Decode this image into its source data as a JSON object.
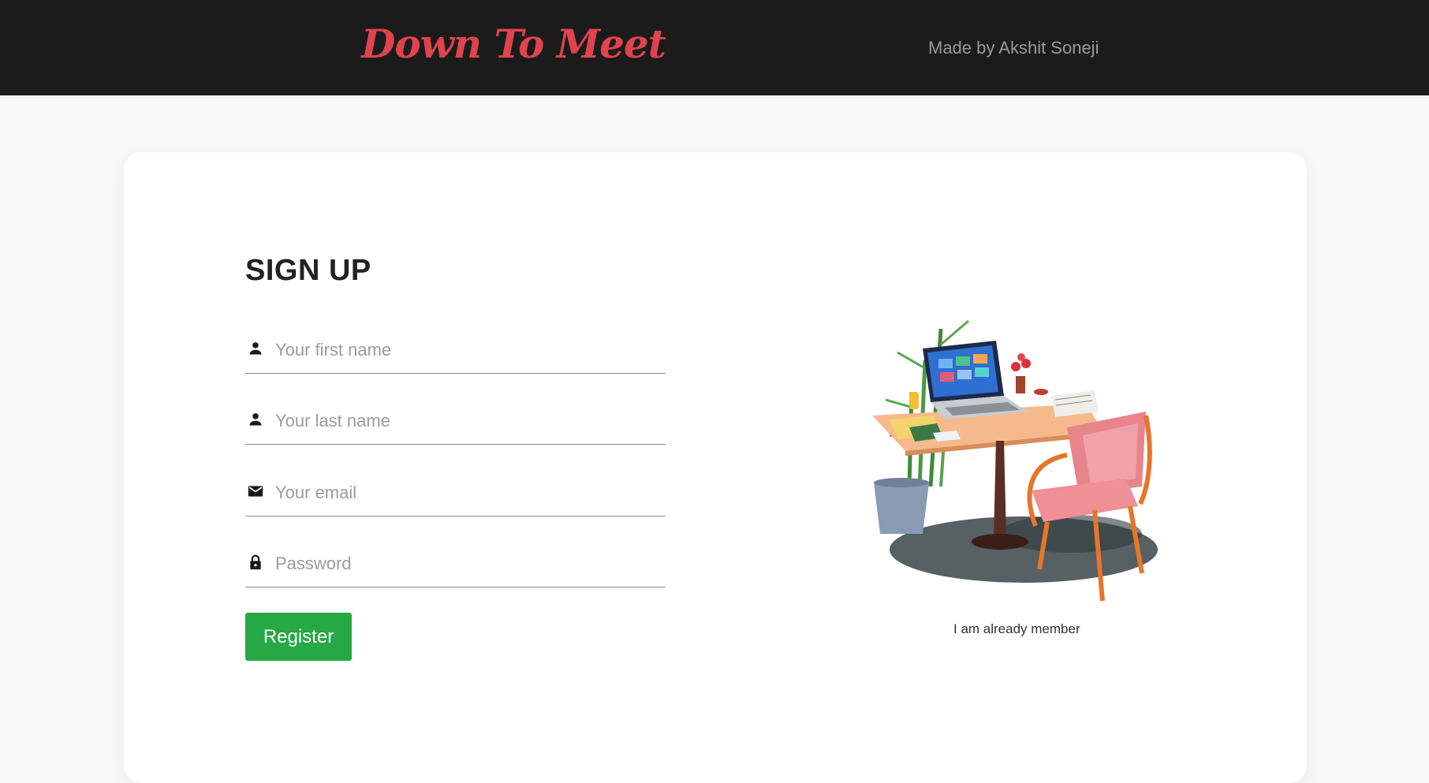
{
  "navbar": {
    "brand": "Down To Meet",
    "credit": "Made by Akshit Soneji"
  },
  "colors": {
    "navbar_bg": "#1b1b1b",
    "brand": "#e0434e",
    "register_button": "#26a845",
    "page_bg": "#f8f8f8"
  },
  "form": {
    "title": "SIGN UP",
    "fields": [
      {
        "icon": "person-icon",
        "placeholder": "Your first name",
        "value": ""
      },
      {
        "icon": "person-icon",
        "placeholder": "Your last name",
        "value": ""
      },
      {
        "icon": "mail-icon",
        "placeholder": "Your email",
        "value": ""
      },
      {
        "icon": "lock-icon",
        "placeholder": "Password",
        "value": ""
      }
    ],
    "submit_label": "Register"
  },
  "aside": {
    "image": "desk-illustration",
    "member_link": "I am already member"
  }
}
